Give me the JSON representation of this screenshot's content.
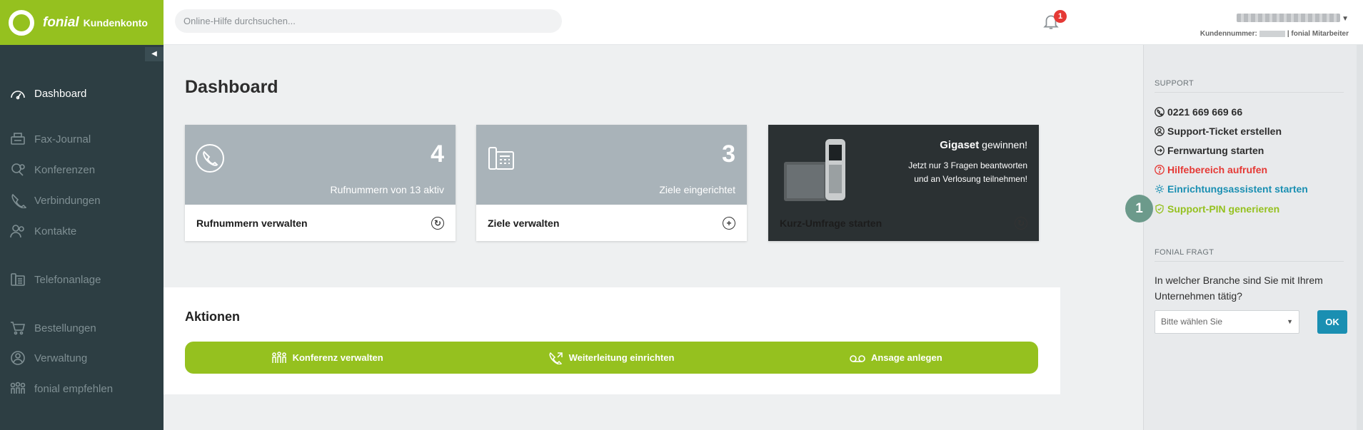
{
  "header": {
    "brand_name": "fonial",
    "brand_sub": "Kundenkonto",
    "search_placeholder": "Online-Hilfe durchsuchen...",
    "notification_count": "1",
    "customer_label": "Kundennummer:",
    "customer_role": "| fonial Mitarbeiter"
  },
  "sidebar": {
    "items": [
      {
        "label": "Dashboard",
        "icon": "dashboard-icon",
        "active": true
      },
      {
        "label": "Fax-Journal",
        "icon": "fax-icon"
      },
      {
        "label": "Konferenzen",
        "icon": "conference-icon"
      },
      {
        "label": "Verbindungen",
        "icon": "connections-icon"
      },
      {
        "label": "Kontakte",
        "icon": "contacts-icon"
      },
      {
        "label": "Telefonanlage",
        "icon": "phone-system-icon"
      },
      {
        "label": "Bestellungen",
        "icon": "cart-icon"
      },
      {
        "label": "Verwaltung",
        "icon": "admin-icon"
      },
      {
        "label": "fonial empfehlen",
        "icon": "recommend-icon"
      }
    ]
  },
  "main": {
    "title": "Dashboard",
    "cards": [
      {
        "number": "4",
        "subtitle": "Rufnummern von 13 aktiv",
        "action": "Rufnummern verwalten"
      },
      {
        "number": "3",
        "subtitle": "Ziele eingerichtet",
        "action": "Ziele verwalten"
      }
    ],
    "promo": {
      "brand": "Gigaset",
      "brand_suffix": " gewinnen!",
      "line1": "Jetzt nur 3 Fragen beantworten",
      "line2": "und an Verlosung teilnehmen!",
      "action": "Kurz-Umfrage starten"
    },
    "actions_title": "Aktionen",
    "actions": [
      {
        "label": "Konferenz verwalten",
        "icon": "conference-icon"
      },
      {
        "label": "Weiterleitung einrichten",
        "icon": "forward-call-icon"
      },
      {
        "label": "Ansage anlegen",
        "icon": "voicemail-icon"
      }
    ]
  },
  "rightbar": {
    "support_heading": "SUPPORT",
    "phone": "0221 669 669 66",
    "ticket": "Support-Ticket erstellen",
    "remote": "Fernwartung starten",
    "help": "Hilfebereich aufrufen",
    "wizard": "Einrichtungsassistent starten",
    "pin": "Support-PIN generieren",
    "question_heading": "FONIAL FRAGT",
    "question": "In welcher Branche sind Sie mit Ihrem Unternehmen tätig?",
    "select_placeholder": "Bitte wählen Sie",
    "ok_label": "OK",
    "step_marker": "1"
  },
  "colors": {
    "brand_green": "#95c11f",
    "sidebar_bg": "#2d3e43",
    "help_red": "#e53935",
    "wizard_blue": "#1a8fb2",
    "pin_green": "#95c11f"
  }
}
